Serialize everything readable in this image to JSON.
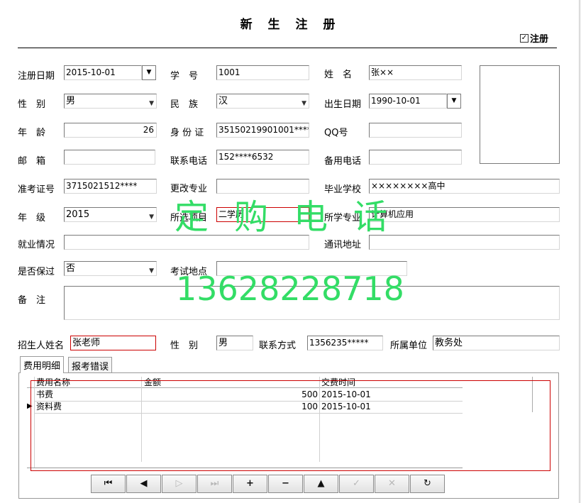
{
  "title": "新 生 注 册",
  "register_checkbox": {
    "label": "注册",
    "checked": true
  },
  "labels": {
    "reg_date": "注册日期",
    "student_no": "学　号",
    "name": "姓　名",
    "gender": "性　别",
    "ethnicity": "民　族",
    "birth_date": "出生日期",
    "age": "年　龄",
    "id_card": "身 份 证",
    "qq": "QQ号",
    "email": "邮　箱",
    "phone": "联系电话",
    "backup_phone": "备用电话",
    "exam_no": "准考证号",
    "change_major": "更改专业",
    "school": "毕业学校",
    "grade": "年　级",
    "project": "所选项目",
    "major": "所学专业",
    "employment": "就业情况",
    "address": "通讯地址",
    "guaranteed": "是否保过",
    "exam_place": "考试地点",
    "remarks": "备　注",
    "recruiter_name": "招生人姓名",
    "recruiter_gender": "性　别",
    "contact": "联系方式",
    "unit": "所属单位"
  },
  "values": {
    "reg_date": "2015-10-01",
    "student_no": "1001",
    "name": "张××",
    "gender": "男",
    "ethnicity": "汉",
    "birth_date": "1990-10-01",
    "age": "26",
    "id_card": "35150219901001****",
    "qq": "",
    "email": "",
    "phone": "152****6532",
    "backup_phone": "",
    "exam_no": "3715021512****",
    "change_major": "",
    "school": "××××××××高中",
    "grade": "2015",
    "project": "二学历",
    "major": "计算机应用",
    "employment": "",
    "address": "",
    "guaranteed": "否",
    "exam_place": "",
    "remarks": "",
    "recruiter_name": "张老师",
    "recruiter_gender": "男",
    "contact": "1356235*****",
    "unit": "教务处"
  },
  "tabs": [
    "费用明细",
    "报考错误"
  ],
  "fee_table": {
    "columns": [
      "费用名称",
      "金额",
      "交费时间"
    ],
    "rows": [
      {
        "name": "书费",
        "amount": "500",
        "date": "2015-10-01"
      },
      {
        "name": "资料费",
        "amount": "100",
        "date": "2015-10-01"
      }
    ]
  },
  "nav_buttons": [
    {
      "icon": "first-record-icon",
      "glyph": "⏮",
      "enabled": true
    },
    {
      "icon": "prev-record-icon",
      "glyph": "◀",
      "enabled": true
    },
    {
      "icon": "next-record-icon",
      "glyph": "▷",
      "enabled": false
    },
    {
      "icon": "last-record-icon",
      "glyph": "⏭",
      "enabled": false
    },
    {
      "icon": "add-icon",
      "glyph": "+",
      "enabled": true
    },
    {
      "icon": "delete-icon",
      "glyph": "−",
      "enabled": true
    },
    {
      "icon": "edit-icon",
      "glyph": "▲",
      "enabled": true
    },
    {
      "icon": "post-icon",
      "glyph": "✓",
      "enabled": false
    },
    {
      "icon": "cancel-icon",
      "glyph": "✕",
      "enabled": false
    },
    {
      "icon": "refresh-icon",
      "glyph": "↻",
      "enabled": true
    }
  ],
  "watermark": {
    "text1": "定购电话",
    "text2": "13628228718"
  },
  "colors": {
    "watermark": "#33dd66",
    "highlight_border": "#cc0000"
  }
}
